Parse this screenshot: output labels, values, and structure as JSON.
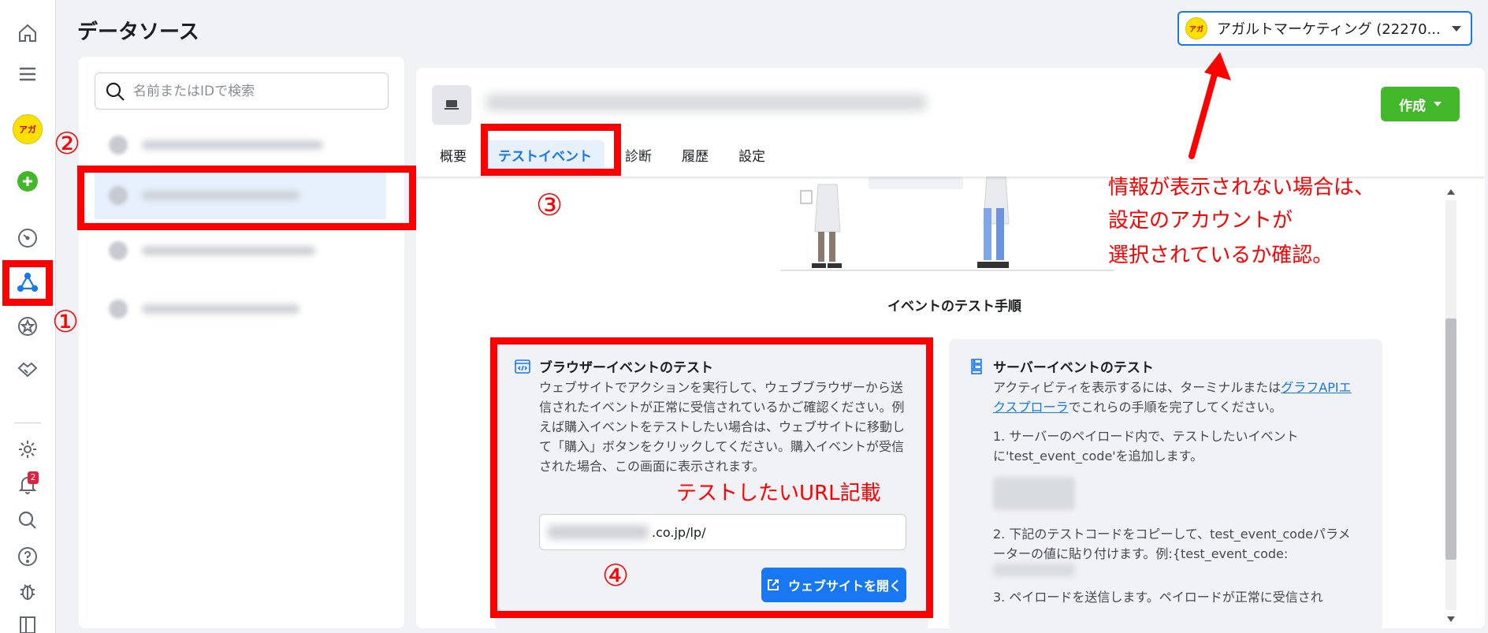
{
  "header": {
    "title": "データソース",
    "account": {
      "name": "アガルトマーケティング (22270...",
      "logo_text": "アガ"
    }
  },
  "rail": {
    "items": [
      {
        "icon": "home-icon"
      },
      {
        "icon": "menu-icon"
      },
      {
        "icon": "account-avatar",
        "label": "アガ"
      },
      {
        "icon": "add-icon"
      },
      {
        "icon": "gauge-icon"
      },
      {
        "icon": "events-manager-icon"
      },
      {
        "icon": "star-icon"
      },
      {
        "icon": "handshake-icon"
      },
      {
        "icon": "gear-icon"
      },
      {
        "icon": "bell-icon",
        "badge": "2"
      },
      {
        "icon": "search-icon"
      },
      {
        "icon": "help-icon"
      },
      {
        "icon": "bug-icon"
      },
      {
        "icon": "panel-icon"
      }
    ]
  },
  "list": {
    "search_placeholder": "名前またはIDで検索"
  },
  "main": {
    "create_label": "作成",
    "tabs": [
      {
        "label": "概要"
      },
      {
        "label": "テストイベント"
      },
      {
        "label": "診断"
      },
      {
        "label": "履歴"
      },
      {
        "label": "設定"
      }
    ],
    "section_title": "イベントのテスト手順",
    "browser_card": {
      "title": "ブラウザーイベントのテスト",
      "body": "ウェブサイトでアクションを実行して、ウェブブラウザーから送信されたイベントが正常に受信されているかご確認ください。例えば購入イベントをテストしたい場合は、ウェブサイトに移動して「購入」ボタンをクリックしてください。購入イベントが受信された場合、この画面に表示されます。",
      "url_suffix": ".co.jp/lp/",
      "open_button": "ウェブサイトを開く"
    },
    "server_card": {
      "title": "サーバーイベントのテスト",
      "intro_prefix": "アクティビティを表示するには、ターミナルまたは",
      "intro_link": "グラフAPIエクスプローラ",
      "intro_suffix": "でこれらの手順を完了してください。",
      "step1": "1. サーバーのペイロード内で、テストしたいイベントに'test_event_code'を追加します。",
      "step2": "2. 下記のテストコードをコピーして、test_event_codeパラメーターの値に貼り付けます。例:{test_event_code:",
      "step3": "3. ペイロードを送信します。ペイロードが正常に受信され"
    }
  },
  "annotations": {
    "num1": "①",
    "num2": "②",
    "num3": "③",
    "num4": "④",
    "url_note": "テストしたいURL記載",
    "account_note_1": "情報が表示されない場合は、",
    "account_note_2": "設定のアカウントが",
    "account_note_3": "選択されているか確認。",
    "color": "#ff0000"
  }
}
